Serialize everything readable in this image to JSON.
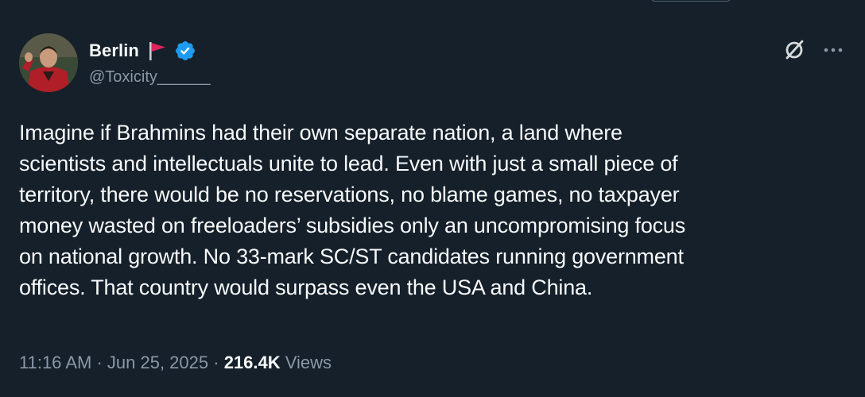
{
  "author": {
    "display_name": "Berlin",
    "handle": "@Toxicity______",
    "badge_icon": "red-flag-icon",
    "verified_icon": "verified-badge-icon",
    "verified_color": "#1d9bf0",
    "flag_color": "#e0245e"
  },
  "actions": {
    "grok_icon": "grok-icon",
    "more_icon": "more-options-icon"
  },
  "tweet": {
    "lines": [
      "Imagine if Brahmins had their own separate nation, a land where",
      "scientists and intellectuals unite to lead. Even with just a small piece of",
      "territory, there would be no reservations, no blame games, no taxpayer",
      "money wasted on freeloaders’ subsidies only an uncompromising focus",
      "on national growth. No 33-mark SC/ST candidates running government",
      "offices. That country would surpass even the USA and China."
    ]
  },
  "meta": {
    "time": "11:16 AM",
    "separator": " · ",
    "date": "Jun 25, 2025",
    "views_count": "216.4K",
    "views_label": "Views"
  },
  "colors": {
    "background": "#15202b",
    "text_primary": "#f7f9f9",
    "text_secondary": "#8b98a5"
  }
}
